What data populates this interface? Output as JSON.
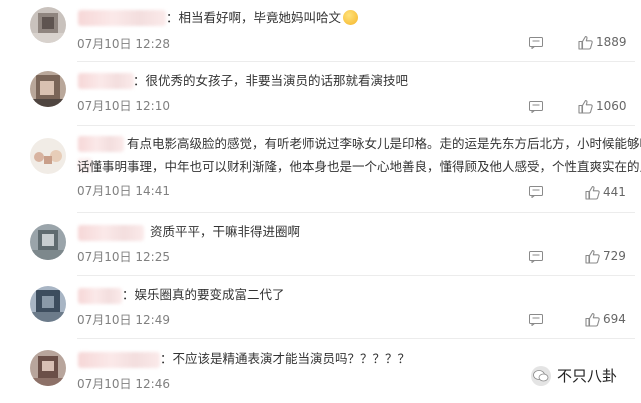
{
  "comments": [
    {
      "prefix": "：",
      "text": "相当看好啊，毕竟她妈叫哈文",
      "emoji": "smiling-face-emoji",
      "date": "07月10日",
      "time": "12:28",
      "likes": "1889"
    },
    {
      "prefix": "：",
      "text": "很优秀的女孩子，非要当演员的话那就看演技吧",
      "date": "07月10日",
      "time": "12:10",
      "likes": "1060"
    },
    {
      "line1": "有点电影高级脸的感觉，有听老师说过李咏女儿是印格。走的运是先东方后北方，小时候能够听",
      "line2": "话懂事明事理，中年也可以财利渐隆，他本身也是一个心地善良，懂得顾及他人感受，个性直爽实在的人",
      "date": "07月10日",
      "time": "14:41",
      "likes": "441"
    },
    {
      "text": "资质平平，干嘛非得进圈啊",
      "date": "07月10日",
      "time": "12:25",
      "likes": "729"
    },
    {
      "prefix": "：",
      "text": "娱乐圈真的要变成富二代了",
      "date": "07月10日",
      "time": "12:49",
      "likes": "694"
    },
    {
      "prefix": "：",
      "text": "不应该是精通表演才能当演员吗？？？？？",
      "date": "07月10日",
      "time": "12:46",
      "likes": "..."
    }
  ],
  "icons": {
    "reply": "comment-bubble-icon",
    "like": "thumbs-up-icon"
  },
  "watermark": {
    "text": "不只八卦"
  },
  "colors": {
    "text": "#333333",
    "meta": "#808080",
    "blurred_name": "#f6d7d7"
  }
}
